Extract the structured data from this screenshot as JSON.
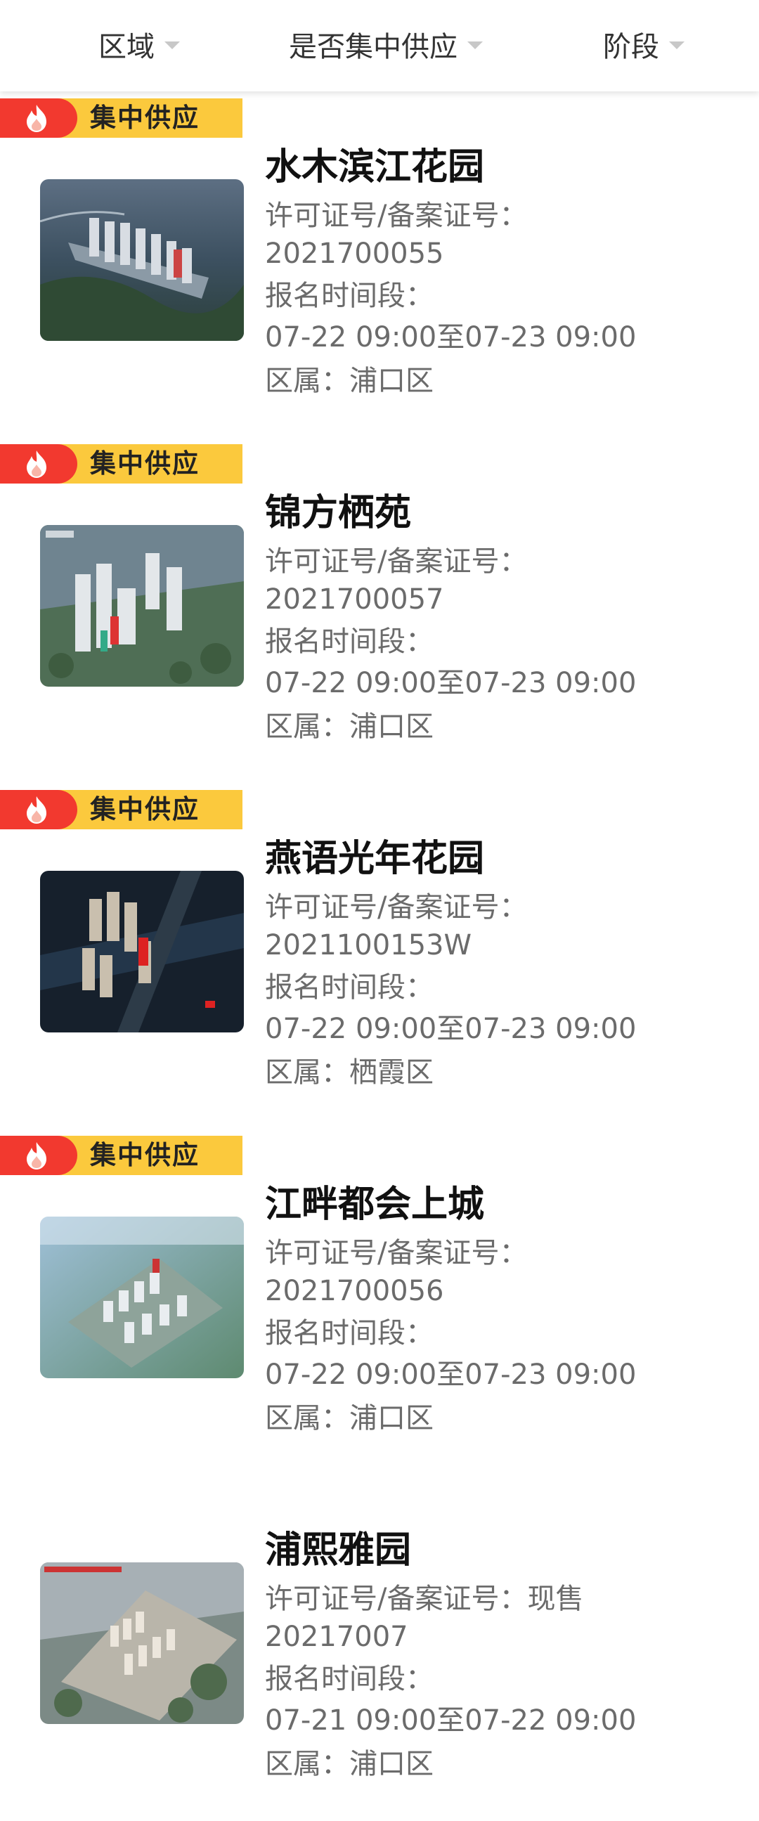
{
  "filters": {
    "region": "区域",
    "centralized": "是否集中供应",
    "stage": "阶段"
  },
  "badge_text": "集中供应",
  "labels": {
    "permit": "许可证号/备案证号：",
    "signup": "报名时间段：",
    "district": "区属："
  },
  "listings": [
    {
      "name": "水木滨江花园",
      "permit_prefix": "",
      "permit": "2021700055",
      "time": "07-22 09:00至07-23 09:00",
      "district": "浦口区",
      "badge": true
    },
    {
      "name": "锦方栖苑",
      "permit_prefix": "",
      "permit": "2021700057",
      "time": "07-22 09:00至07-23 09:00",
      "district": "浦口区",
      "badge": true
    },
    {
      "name": "燕语光年花园",
      "permit_prefix": "",
      "permit": "2021100153W",
      "time": "07-22 09:00至07-23 09:00",
      "district": "栖霞区",
      "badge": true
    },
    {
      "name": "江畔都会上城",
      "permit_prefix": "",
      "permit": "2021700056",
      "time": "07-22 09:00至07-23 09:00",
      "district": "浦口区",
      "badge": true
    },
    {
      "name": "浦熙雅园",
      "permit_prefix": "现售",
      "permit": "20217007",
      "time": "07-21 09:00至07-22 09:00",
      "district": "浦口区",
      "badge": false
    }
  ]
}
